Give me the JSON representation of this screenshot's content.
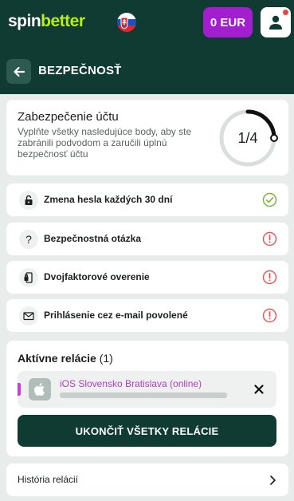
{
  "header": {
    "logo_part1": "spin",
    "logo_part2": "better",
    "balance_label": "0 EUR",
    "flag_icon": "slovakia-flag-icon",
    "profile_icon": "user-icon"
  },
  "subheader": {
    "title": "BEZPEČNOSŤ",
    "back_icon": "arrow-left-icon"
  },
  "security": {
    "title": "Zabezpečenie účtu",
    "description": "Vyplňte všetky nasledujúce body, aby ste zabránili podvodom a zaručili úplnú bezpečnosť účtu",
    "progress_text": "1/4",
    "progress_fraction": 0.25
  },
  "items": [
    {
      "label": "Zmena hesla každých 30 dní",
      "icon": "lock-icon",
      "status": "done"
    },
    {
      "label": "Bezpečnostná otázka",
      "icon": "question-icon",
      "status": "pending"
    },
    {
      "label": "Dvojfaktorové overenie",
      "icon": "two-factor-icon",
      "status": "pending"
    },
    {
      "label": "Prihlásenie cez e-mail povolené",
      "icon": "envelope-icon",
      "status": "pending"
    }
  ],
  "sessions": {
    "title": "Aktívne relácie",
    "count": "(1)",
    "list": [
      {
        "name": "iOS Slovensko Bratislava (online)",
        "device_icon": "apple-icon"
      }
    ],
    "end_all_label": "UKONČIŤ VŠETKY RELÁCIE"
  },
  "history": {
    "label": "História relácií"
  },
  "colors": {
    "header_bg": "#0f3b33",
    "accent_lime": "#b7ee1b",
    "balance_purple": "#a21ecf",
    "session_accent": "#c63fd6",
    "status_done": "#7bb33a",
    "status_pending": "#e05a5a"
  }
}
